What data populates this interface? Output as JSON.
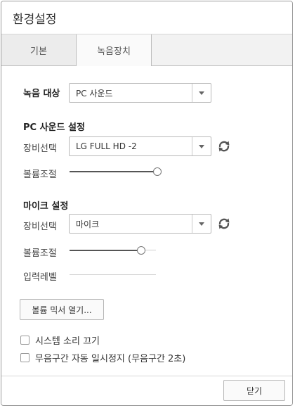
{
  "window": {
    "title": "환경설정"
  },
  "tabs": [
    {
      "label": "기본",
      "active": false
    },
    {
      "label": "녹음장치",
      "active": true
    }
  ],
  "recording_target": {
    "label": "녹음 대상",
    "selected": "PC 사운드"
  },
  "pc_sound": {
    "section_title": "PC 사운드 설정",
    "device_label": "장비선택",
    "device_selected": "LG FULL HD -2",
    "volume_label": "볼륨조절",
    "volume_level": 1.0
  },
  "mic": {
    "section_title": "마이크 설정",
    "device_label": "장비선택",
    "device_selected": "마이크",
    "volume_label": "볼륨조절",
    "volume_level": 0.82,
    "input_level_label": "입력레벨"
  },
  "buttons": {
    "volume_mixer": "볼륨 믹서 열기...",
    "close": "닫기"
  },
  "options": [
    {
      "label": "시스템 소리 끄기",
      "checked": false
    },
    {
      "label": "무음구간 자동 일시정지 (무음구간 2초)",
      "checked": false
    }
  ],
  "icons": {
    "refresh": "refresh-icon",
    "dropdown": "chevron-down-icon"
  },
  "colors": {
    "border": "#9a9a9a",
    "tab_bg": "#ececec",
    "active_tab_bg": "#fafafa",
    "icon": "#555555"
  }
}
